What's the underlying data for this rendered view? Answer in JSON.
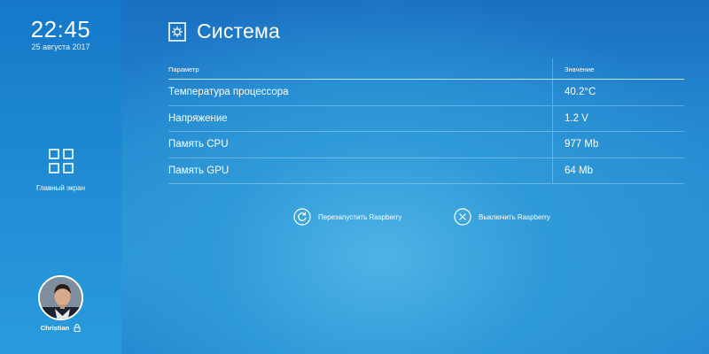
{
  "sidebar": {
    "time": "22:45",
    "date": "25 августа 2017",
    "home_label": "Главный экран",
    "home_icon": "grid-icon",
    "user_name": "Christian",
    "lock_icon": "lock-icon"
  },
  "main": {
    "title": "Система",
    "title_icon": "settings-gear-icon",
    "table": {
      "headers": {
        "param": "Параметр",
        "value": "Значение"
      },
      "rows": [
        {
          "param": "Температура процессора",
          "value": "40.2°C"
        },
        {
          "param": "Напряжение",
          "value": "1.2 V"
        },
        {
          "param": "Память CPU",
          "value": "977 Mb"
        },
        {
          "param": "Память GPU",
          "value": "64 Mb"
        }
      ]
    },
    "actions": {
      "restart_label": "Перезапустить Raspberry",
      "restart_icon": "restart-icon",
      "shutdown_label": "Выключить Raspberry",
      "shutdown_icon": "close-circle-icon"
    }
  },
  "colors": {
    "background": "#2b95d6",
    "sidebar": "#1e8ad3",
    "text": "#ffffff"
  }
}
